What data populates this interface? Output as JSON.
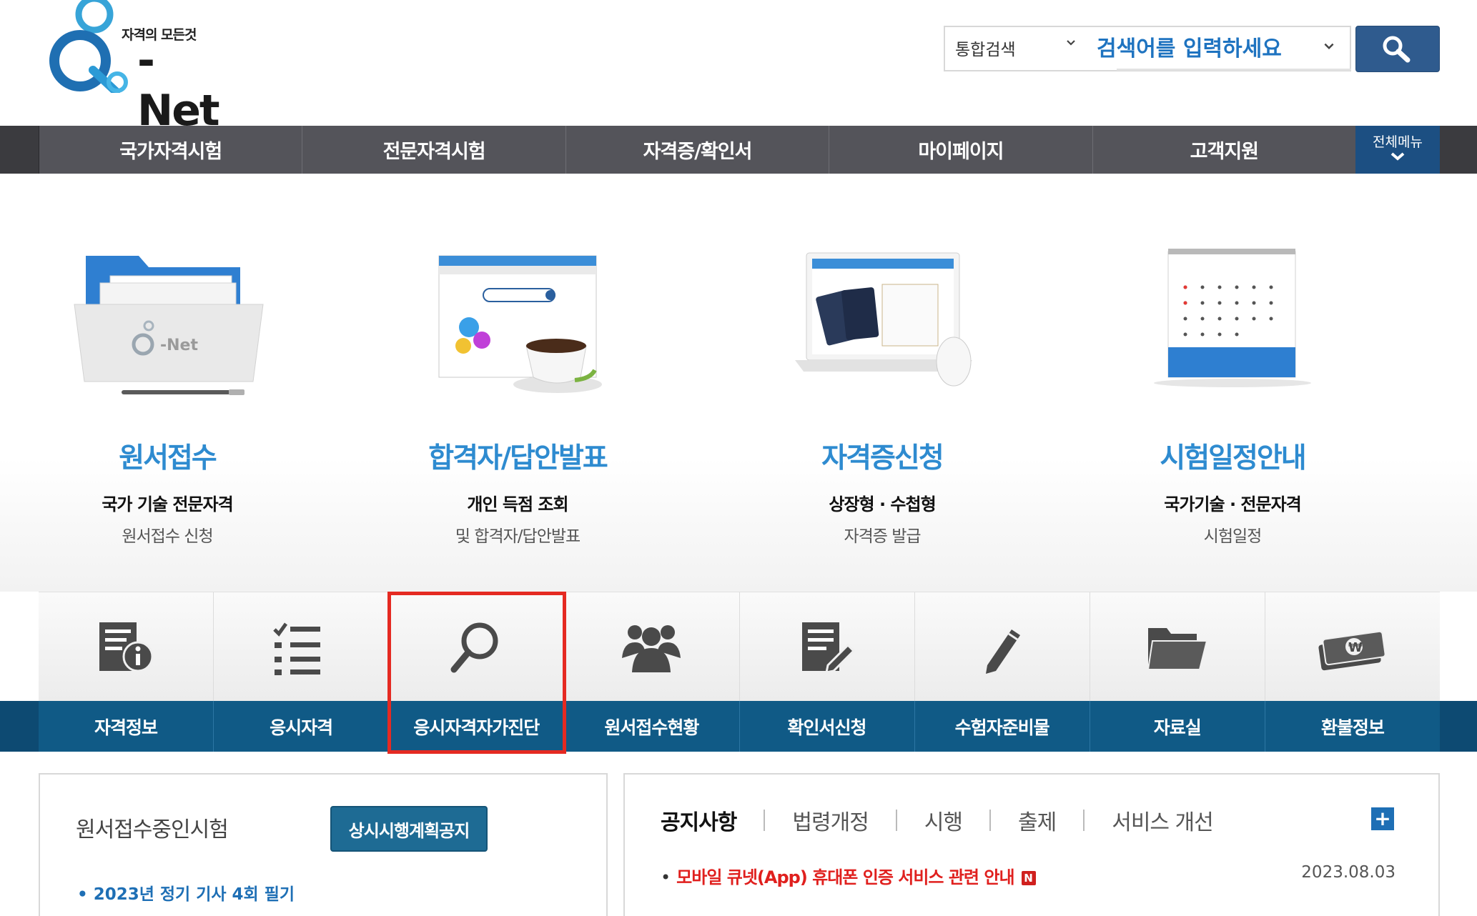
{
  "brand": {
    "tagline": "자격의 모든것",
    "wordmark": "-Net"
  },
  "search": {
    "scope": "통합검색",
    "placeholder": "검색어를 입력하세요",
    "button_icon": "magnifier-icon"
  },
  "gnb": {
    "items": [
      "국가자격시험",
      "전문자격시험",
      "자격증/확인서",
      "마이페이지",
      "고객지원"
    ],
    "all_menu_label": "전체메뉴"
  },
  "services": [
    {
      "title": "원서접수",
      "sub1": "국가 기술 전문자격",
      "sub2": "원서접수 신청",
      "icon": "folder-illustration"
    },
    {
      "title": "합격자/답안발표",
      "sub1": "개인 득점 조회",
      "sub2": "및 합격자/답안발표",
      "icon": "browser-coffee-illustration"
    },
    {
      "title": "자격증신청",
      "sub1": "상장형 · 수첩형",
      "sub2": "자격증 발급",
      "icon": "laptop-passport-illustration"
    },
    {
      "title": "시험일정안내",
      "sub1": "국가기술 · 전문자격",
      "sub2": "시험일정",
      "icon": "calendar-illustration"
    }
  ],
  "quick_menu": [
    {
      "label": "자격정보",
      "icon": "document-info-icon"
    },
    {
      "label": "응시자격",
      "icon": "checklist-icon"
    },
    {
      "label": "응시자격자가진단",
      "icon": "magnifier-icon"
    },
    {
      "label": "원서접수현황",
      "icon": "people-group-icon"
    },
    {
      "label": "확인서신청",
      "icon": "document-edit-icon"
    },
    {
      "label": "수험자준비물",
      "icon": "pencil-icon"
    },
    {
      "label": "자료실",
      "icon": "folder-icon"
    },
    {
      "label": "환불정보",
      "icon": "money-icon"
    }
  ],
  "highlight": {
    "target": "응시자격자가진단",
    "color": "#e52a22"
  },
  "left_panel": {
    "title": "원서접수중인시험",
    "button": "상시시행계획공지",
    "list": [
      "2023년 정기 기사 4회 필기"
    ]
  },
  "right_panel": {
    "tabs": [
      "공지사항",
      "법령개정",
      "시행",
      "출제",
      "서비스 개선"
    ],
    "active_tab": "공지사항",
    "more": "+",
    "notices": [
      {
        "text": "모바일 큐넷(App) 휴대폰 인증 서비스 관련 안내",
        "badge": "N",
        "date": "2023.08.03"
      }
    ]
  },
  "colors": {
    "brand_blue": "#2e8bd0",
    "nav_dark": "#54545a",
    "quick_bar": "#105a86",
    "notice_red": "#e0201e"
  }
}
